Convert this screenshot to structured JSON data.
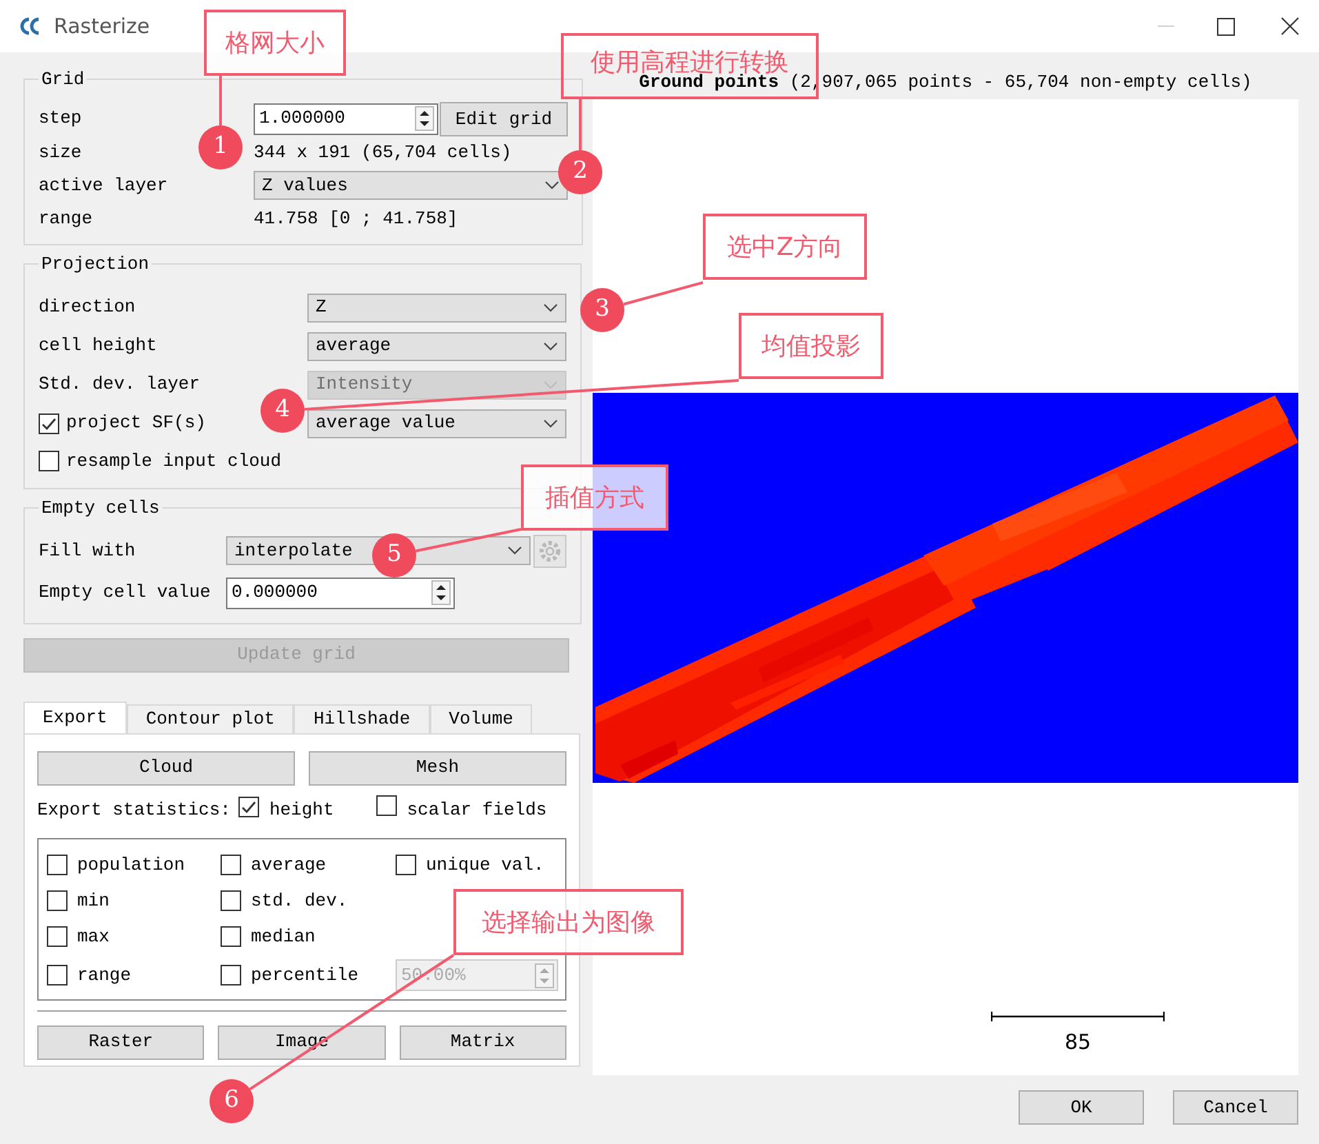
{
  "window": {
    "title": "Rasterize",
    "minimize_disabled": true
  },
  "grid": {
    "title": "Grid",
    "step": {
      "label": "step",
      "value": "1.000000",
      "button": "Edit grid"
    },
    "size": {
      "label": "size",
      "value": "344 x 191 (65,704 cells)"
    },
    "active_layer": {
      "label": "active layer",
      "value": "Z values"
    },
    "range": {
      "label": "range",
      "value": "41.758 [0 ; 41.758]"
    }
  },
  "projection": {
    "title": "Projection",
    "rows": [
      {
        "kind": "combo",
        "label": "direction",
        "value": "Z",
        "disabled": false
      },
      {
        "kind": "combo",
        "label": "cell height",
        "value": "average",
        "disabled": false
      },
      {
        "kind": "combo",
        "label": "Std. dev. layer",
        "value": "Intensity",
        "disabled": true
      },
      {
        "kind": "check_combo",
        "label": "project SF(s)",
        "checked": true,
        "value": "average value",
        "disabled": false
      },
      {
        "kind": "check",
        "label": "resample input cloud",
        "checked": false
      }
    ]
  },
  "empty_cells": {
    "title": "Empty cells",
    "fill_with": {
      "label": "Fill with",
      "value": "interpolate"
    },
    "empty_value": {
      "label": "Empty cell value",
      "value": "0.000000"
    }
  },
  "update_button": {
    "label": "Update grid",
    "disabled": true
  },
  "tabs": [
    {
      "label": "Export",
      "selected": true
    },
    {
      "label": "Contour plot",
      "selected": false
    },
    {
      "label": "Hillshade",
      "selected": false
    },
    {
      "label": "Volume",
      "selected": false
    }
  ],
  "export": {
    "buttons": [
      "Cloud",
      "Mesh"
    ],
    "stats_label": "Export statistics:",
    "height": {
      "label": "height",
      "checked": true
    },
    "scalar_fields": {
      "label": "scalar fields",
      "checked": false
    },
    "stat_columns": [
      [
        {
          "label": "population",
          "checked": false
        },
        {
          "label": "min",
          "checked": false
        },
        {
          "label": "max",
          "checked": false
        },
        {
          "label": "range",
          "checked": false
        }
      ],
      [
        {
          "label": "average",
          "checked": false
        },
        {
          "label": "std. dev.",
          "checked": false
        },
        {
          "label": "median",
          "checked": false
        },
        {
          "label": "percentile",
          "checked": false
        }
      ],
      [
        {
          "label": "unique val.",
          "checked": false
        }
      ]
    ],
    "percentile_value": {
      "value": "50.00%",
      "disabled": true
    },
    "output_buttons": [
      "Raster",
      "Image",
      "Matrix"
    ]
  },
  "view": {
    "title": "**Ground points** (2,907,065 points - 65,704 non-empty cells)",
    "scale_label": "85"
  },
  "dialog_buttons": [
    "OK",
    "Cancel"
  ],
  "annotations": [
    {
      "number": "1",
      "text": "格网大小"
    },
    {
      "number": "2",
      "text": "使用高程进行转换"
    },
    {
      "number": "3",
      "text": "选中Z方向"
    },
    {
      "number": "4",
      "text": "均值投影"
    },
    {
      "number": "5",
      "text": "插值方式"
    },
    {
      "number": "6",
      "text": "选择输出为图像"
    }
  ]
}
